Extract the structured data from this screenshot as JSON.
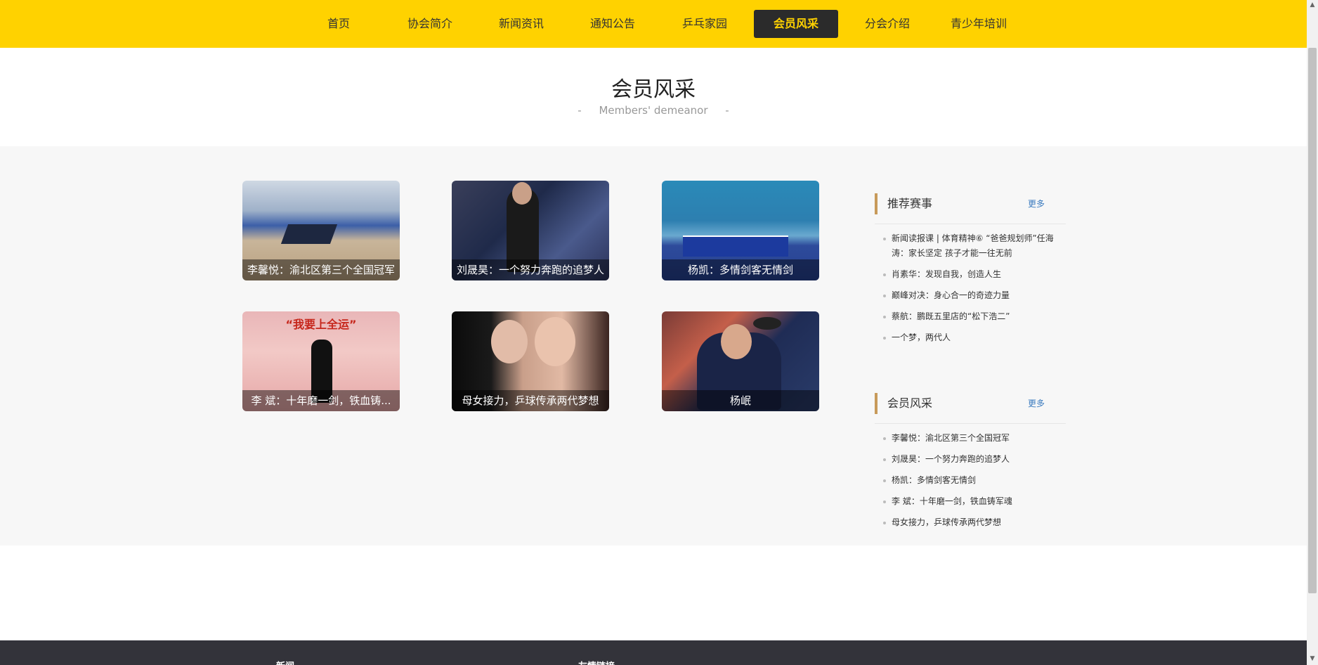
{
  "nav": {
    "items": [
      {
        "label": "首页"
      },
      {
        "label": "协会简介"
      },
      {
        "label": "新闻资讯"
      },
      {
        "label": "通知公告"
      },
      {
        "label": "乒乓家园"
      },
      {
        "label": "会员风采",
        "active": true
      },
      {
        "label": "分会介绍"
      },
      {
        "label": "青少年培训"
      }
    ]
  },
  "header": {
    "title": "会员风采",
    "subtitle": "Members' demeanor",
    "dash": "-"
  },
  "cards": [
    {
      "caption": "李馨悦：渝北区第三个全国冠军"
    },
    {
      "caption": "刘晟昊：一个努力奔跑的追梦人"
    },
    {
      "caption": "杨凯：多情剑客无情剑"
    },
    {
      "caption": "李 斌：十年磨一剑，铁血铸..."
    },
    {
      "caption": "母女接力，乒球传承两代梦想"
    },
    {
      "caption": "杨岷"
    }
  ],
  "poster_banner": "“我要上全运”",
  "sidebar": {
    "recommended": {
      "title": "推荐赛事",
      "more": "更多",
      "items": [
        "新闻读报课 | 体育精神⑥ “爸爸规划师”任海涛：家长坚定 孩子才能一往无前",
        "肖素华：发现自我，创造人生",
        "巅峰对决：身心合一的奇迹力量",
        "蔡航：鹏既五里店的“松下浩二”",
        "一个梦，两代人"
      ]
    },
    "members": {
      "title": "会员风采",
      "more": "更多",
      "items": [
        "李馨悦：渝北区第三个全国冠军",
        "刘晟昊：一个努力奔跑的追梦人",
        "杨凯：多情剑客无情剑",
        "李 斌：十年磨一剑，铁血铸军魂",
        "母女接力，乒球传承两代梦想"
      ]
    }
  },
  "footer": {
    "col1": "新闻",
    "col2": "友情链接"
  },
  "colors": {
    "nav_bg": "#ffd200",
    "nav_active_bg": "#2b2b2b",
    "accent_bar": "#c79a5a",
    "more_link": "#3b7bbf",
    "footer_bg": "#33333a"
  }
}
